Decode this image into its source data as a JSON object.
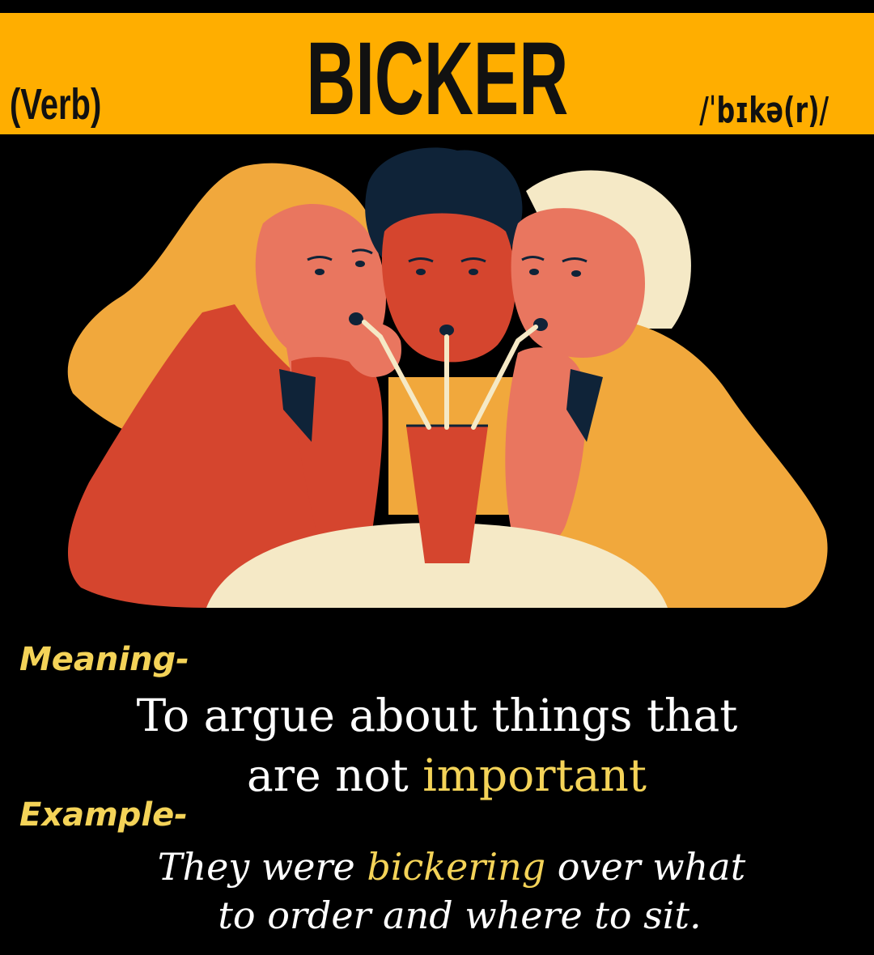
{
  "header": {
    "part_of_speech": "(Verb)",
    "word": "BICKER",
    "pronunciation": "/ˈbɪkə(r)/"
  },
  "colors": {
    "header_bg": "#FFAE00",
    "page_bg": "#000000",
    "label": "#F4D358",
    "highlight": "#F4D358",
    "text": "#FFFFFF"
  },
  "illustration": {
    "icons": [
      "woman-left-icon",
      "woman-center-icon",
      "woman-right-icon",
      "cup-icon",
      "straw-icon",
      "table-icon"
    ]
  },
  "meaning": {
    "label": "Meaning-",
    "line1": "To argue about things that",
    "line2_before": "are not ",
    "line2_highlight": "important"
  },
  "example": {
    "label": "Example-",
    "line1_before": "They were ",
    "line1_highlight": "bickering",
    "line1_after": " over what",
    "line2": "to order and where to sit."
  }
}
